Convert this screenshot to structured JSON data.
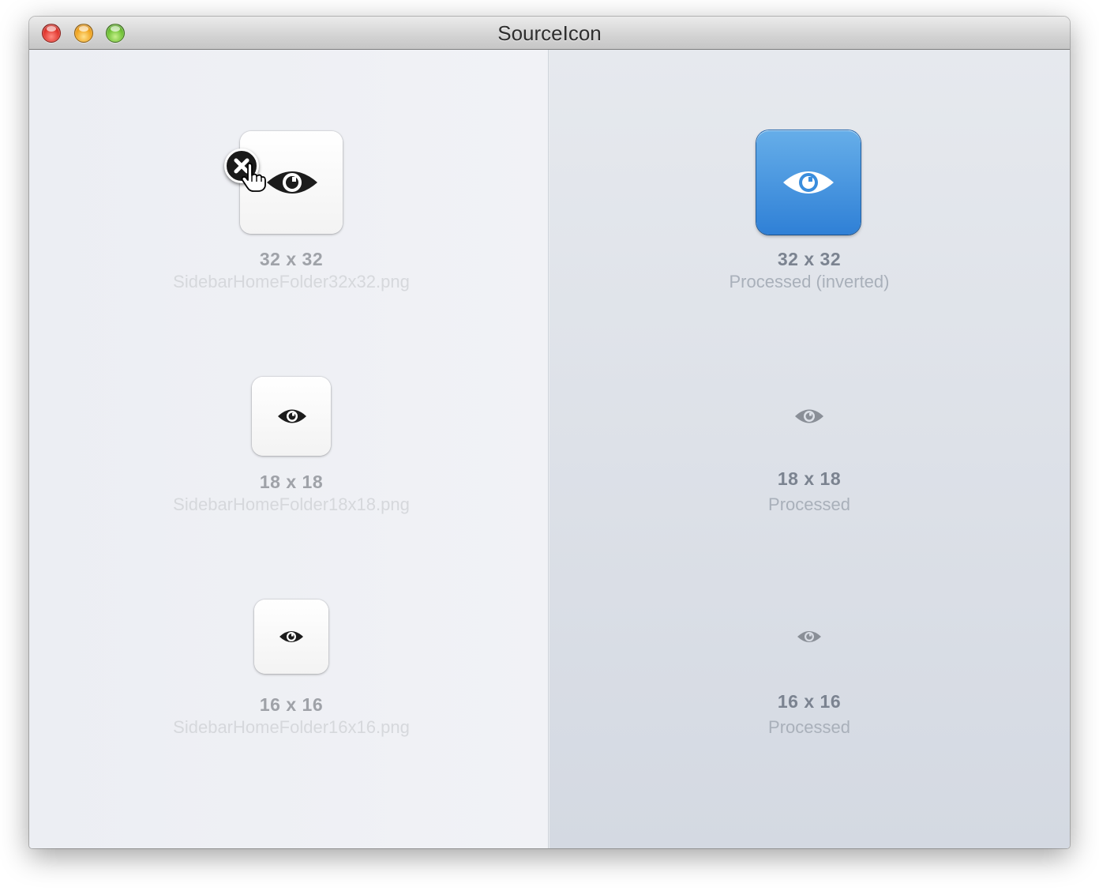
{
  "window": {
    "title": "SourceIcon",
    "buttons": [
      "close",
      "minimize",
      "zoom"
    ]
  },
  "source_pane": {
    "items": [
      {
        "size": "32 x 32",
        "filename": "SidebarHomeFolder32x32.png",
        "icon": "eye-icon"
      },
      {
        "size": "18 x 18",
        "filename": "SidebarHomeFolder18x18.png",
        "icon": "eye-icon"
      },
      {
        "size": "16 x 16",
        "filename": "SidebarHomeFolder16x16.png",
        "icon": "eye-icon"
      }
    ],
    "remove_icon": "close-circle-icon",
    "cursor_icon": "pointing-hand-cursor-icon"
  },
  "processed_pane": {
    "items": [
      {
        "size": "32 x 32",
        "caption": "Processed (inverted)",
        "icon": "eye-icon"
      },
      {
        "size": "18 x 18",
        "caption": "Processed",
        "icon": "eye-icon"
      },
      {
        "size": "16 x 16",
        "caption": "Processed",
        "icon": "eye-icon"
      }
    ]
  },
  "colors": {
    "selected_tile": "#3a8ddd",
    "eye_dark": "#1c1c1c",
    "eye_processed": "#8a8f97"
  }
}
